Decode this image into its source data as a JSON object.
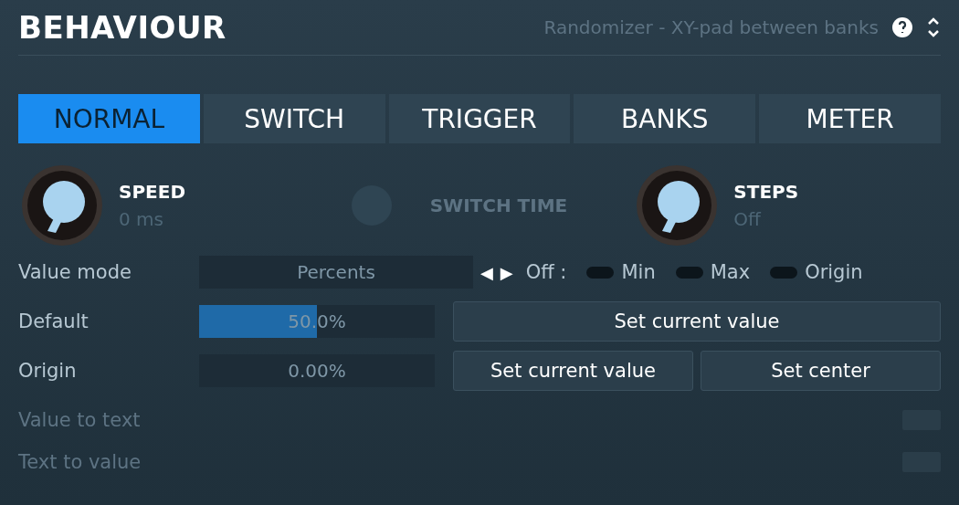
{
  "title": "BEHAVIOUR",
  "header_link": {
    "text": "Randomizer - XY-pad between banks",
    "disabled": true
  },
  "tabs": [
    {
      "label": "NORMAL",
      "selected": true
    },
    {
      "label": "SWITCH",
      "selected": false
    },
    {
      "label": "TRIGGER",
      "selected": false
    },
    {
      "label": "BANKS",
      "selected": false
    },
    {
      "label": "METER",
      "selected": false
    }
  ],
  "knobs": [
    {
      "label": "SPEED",
      "value": "0 ms",
      "disabled": false
    },
    {
      "label": "SWITCH TIME",
      "disabled": true
    },
    {
      "label": "STEPS",
      "value": "Off",
      "disabled": false
    }
  ],
  "value_mode": {
    "label": "Value mode",
    "value": "Percents",
    "prev": "◀",
    "next": "▶",
    "off_label": "Off :"
  },
  "toggles": [
    {
      "label": "Min",
      "on": false
    },
    {
      "label": "Max",
      "on": false
    },
    {
      "label": "Origin",
      "on": false
    }
  ],
  "default": {
    "label": "Default",
    "value": "50.0%",
    "level": 0.5,
    "button": "Set current value"
  },
  "origin": {
    "label": "Origin",
    "value": "0.00%",
    "buttons": [
      "Set current value",
      "Set center"
    ]
  },
  "conversions": [
    {
      "label": "Value to text",
      "disabled": true
    },
    {
      "label": "Text to value",
      "disabled": true
    }
  ]
}
